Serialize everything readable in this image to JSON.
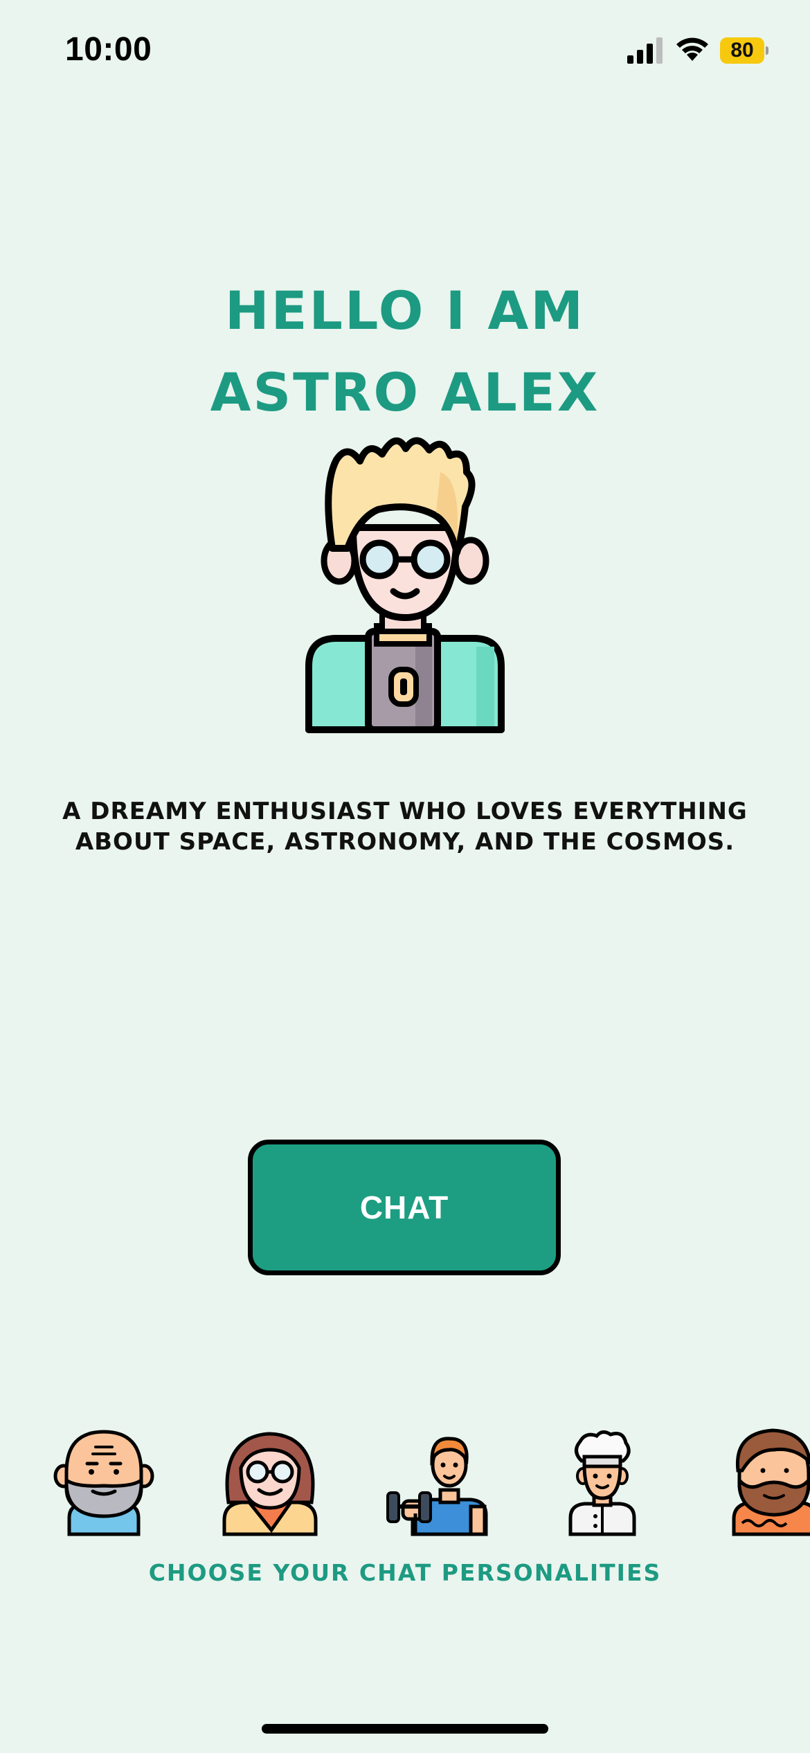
{
  "status_bar": {
    "time": "10:00",
    "battery_level": "80",
    "icons": [
      "signal-icon",
      "wifi-icon",
      "battery-icon"
    ],
    "battery_color": "#f6c90e"
  },
  "hero": {
    "title_line1": "HELLO I AM",
    "title_line2": "ASTRO ALEX",
    "avatar": "astro-alex-avatar",
    "description_line1": "A DREAMY ENTHUSIAST WHO LOVES EVERYTHING",
    "description_line2": "ABOUT SPACE, ASTRONOMY, AND THE COSMOS."
  },
  "actions": {
    "chat_label": "CHAT"
  },
  "personalities": {
    "label": "CHOOSE YOUR CHAT PERSONALITIES",
    "items": [
      {
        "icon": "old-sage-avatar"
      },
      {
        "icon": "woman-glasses-avatar"
      },
      {
        "icon": "fitness-trainer-avatar"
      },
      {
        "icon": "chef-avatar"
      },
      {
        "icon": "bearded-man-avatar"
      }
    ]
  },
  "theme": {
    "background": "#e9f5ee",
    "accent": "#1d9a82",
    "button": "#1d9e82"
  }
}
